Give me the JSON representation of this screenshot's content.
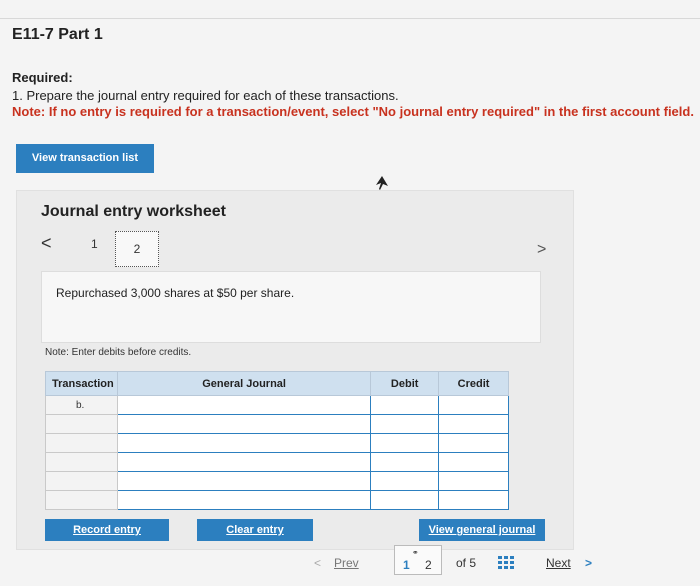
{
  "page": {
    "title": "E11-7 Part 1",
    "required_label": "Required:",
    "instruction": "1. Prepare the journal entry required for each of these transactions.",
    "note": "Note: If no entry is required for a transaction/event, select \"No journal entry required\" in the first account field."
  },
  "buttons": {
    "view_transaction_list": "View transaction list",
    "record_entry": "Record entry",
    "clear_entry": "Clear entry",
    "view_general_journal": "View general journal"
  },
  "worksheet": {
    "title": "Journal entry worksheet",
    "prev_arrow": "<",
    "next_arrow": ">",
    "page_1": "1",
    "page_2": "2",
    "description": "Repurchased 3,000 shares at $50 per share.",
    "debits_note": "Note: Enter debits before credits.",
    "columns": [
      "Transaction",
      "General Journal",
      "Debit",
      "Credit"
    ],
    "first_transaction": "b."
  },
  "pager": {
    "prev_arrow": "<",
    "prev": "Prev",
    "current": "1",
    "next_page": "2",
    "of_total": "of 5",
    "next": "Next",
    "next_arrow": ">"
  },
  "colors": {
    "accent": "#2c7fbf",
    "note_red": "#c8321f",
    "table_header": "#cfe0ef"
  }
}
